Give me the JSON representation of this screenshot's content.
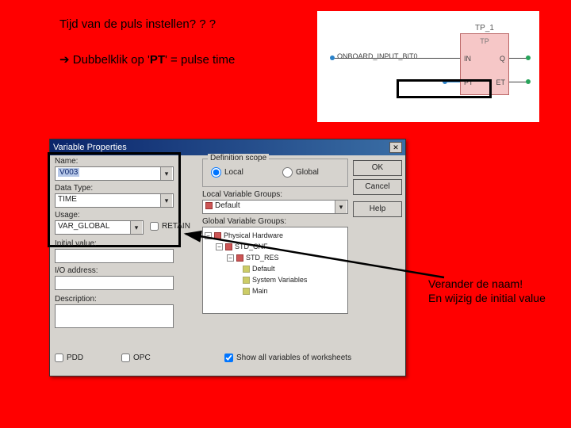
{
  "slide": {
    "heading": "Tijd van de puls instellen? ? ?",
    "bullet_arrow": "➔",
    "bullet_text_pre": "Dubbelklik op '",
    "bullet_text_bold": "PT",
    "bullet_text_post": "' = pulse time",
    "note1": "Verander de naam!",
    "note2": "En wijzig de initial value"
  },
  "diagram": {
    "block_title": "TP_1",
    "block_type": "TP",
    "left_signal": "ONBOARD_INPUT_BIT0",
    "port_in": "IN",
    "port_pt": "PT",
    "port_q": "Q",
    "port_et": "ET"
  },
  "dialog": {
    "title": "Variable Properties",
    "close": "✕",
    "labels": {
      "name": "Name:",
      "data_type": "Data Type:",
      "usage": "Usage:",
      "retain": "RETAIN",
      "init_value": "Initial value:",
      "io_address": "I/O address:",
      "description": "Description:",
      "def_scope": "Definition scope",
      "local": "Local",
      "global": "Global",
      "local_var_groups": "Local Variable Groups:",
      "global_var_groups": "Global Variable Groups:",
      "pdd": "PDD",
      "opc": "OPC",
      "show_all": "Show all variables of worksheets"
    },
    "values": {
      "name": "V003",
      "data_type": "TIME",
      "usage": "VAR_GLOBAL",
      "retain_checked": false,
      "init_value": "",
      "io_address": "",
      "description": "",
      "local_group": "Default",
      "pdd_checked": false,
      "opc_checked": false,
      "show_all_checked": true
    },
    "tree": {
      "root": "Physical Hardware",
      "n1": "STD_CNF",
      "n2": "STD_RES",
      "leaf1": "Default",
      "leaf2": "System Variables",
      "leaf3": "Main"
    },
    "buttons": {
      "ok": "OK",
      "cancel": "Cancel",
      "help": "Help"
    }
  }
}
